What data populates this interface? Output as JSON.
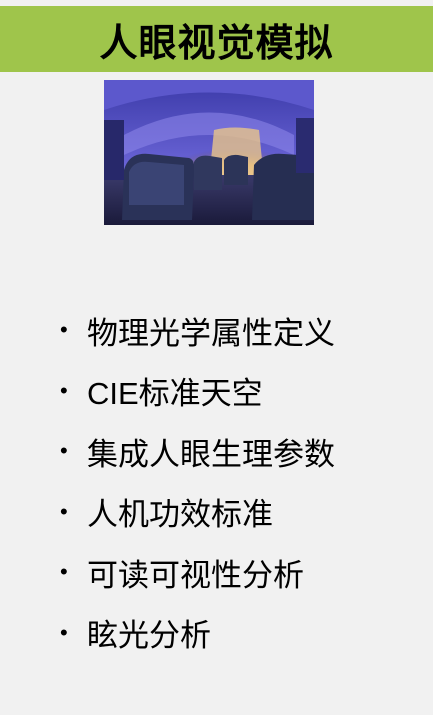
{
  "title": "人眼视觉模拟",
  "image": {
    "subject": "aircraft-cabin-interior"
  },
  "colors": {
    "title_bar": "#9fc54b",
    "background": "#f1f1f1",
    "bullet_text": "#000000"
  },
  "bullets": [
    "物理光学属性定义",
    "CIE标准天空",
    "集成人眼生理参数",
    "人机功效标准",
    "可读可视性分析",
    "眩光分析"
  ]
}
